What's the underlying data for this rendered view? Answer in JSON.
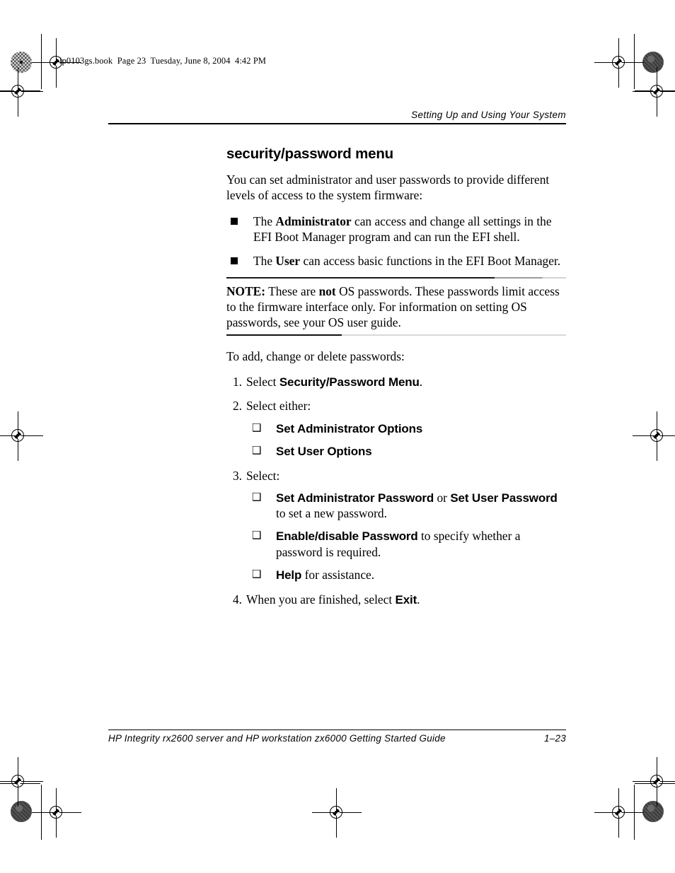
{
  "slug": {
    "text": "lp0103gs.book  Page 23  Tuesday, June 8, 2004  4:42 PM"
  },
  "header": {
    "running_head": "Setting Up and Using Your System"
  },
  "content": {
    "section_title": "security/password menu",
    "intro_paragraph": "You can set administrator and user passwords to provide different levels of access to the system firmware:",
    "bullets": [
      {
        "lead": "The ",
        "term": "Administrator",
        "rest": " can access and change all settings in the EFI Boot Manager program and can run the EFI shell."
      },
      {
        "lead": "The ",
        "term": "User",
        "rest": " can access basic functions in the EFI Boot Manager."
      }
    ],
    "note": {
      "label": "NOTE:",
      "part1": " These are ",
      "emphasis": "not",
      "part2": " OS passwords. These passwords limit access to the firmware interface only. For information on setting OS passwords, see your OS user guide."
    },
    "lead_in": "To add, change or delete passwords:",
    "steps": [
      {
        "num": "1.",
        "text_before": "Select ",
        "ui_label": "Security/Password Menu",
        "text_after": "."
      },
      {
        "num": "2.",
        "text_before": "Select either:",
        "ui_label": "",
        "text_after": "",
        "sub_items": [
          {
            "glyph": "❑",
            "ui_label": "Set Administrator Options",
            "text_after": ""
          },
          {
            "glyph": "❑",
            "ui_label": "Set User Options",
            "text_after": ""
          }
        ]
      },
      {
        "num": "3.",
        "text_before": "Select:",
        "ui_label": "",
        "text_after": "",
        "sub_items": [
          {
            "glyph": "❑",
            "ui_label": "Set Administrator Password",
            "mid_text": " or ",
            "ui_label2": "Set User Password",
            "text_after": " to set a new password."
          },
          {
            "glyph": "❑",
            "ui_label": "Enable/disable Password",
            "text_after": " to specify whether a password is required."
          },
          {
            "glyph": "❑",
            "ui_label": "Help",
            "text_after": " for assistance."
          }
        ]
      },
      {
        "num": "4.",
        "text_before": "When you are finished, select ",
        "ui_label": "Exit",
        "text_after": "."
      }
    ]
  },
  "footer": {
    "title": "HP Integrity rx2600 server and HP workstation zx6000 Getting Started Guide",
    "page_number": "1–23"
  },
  "marks": {
    "registration_icon": "registration-target",
    "halftone_icon": "halftone-density-circle",
    "solid_icon": "solid-density-circle"
  }
}
